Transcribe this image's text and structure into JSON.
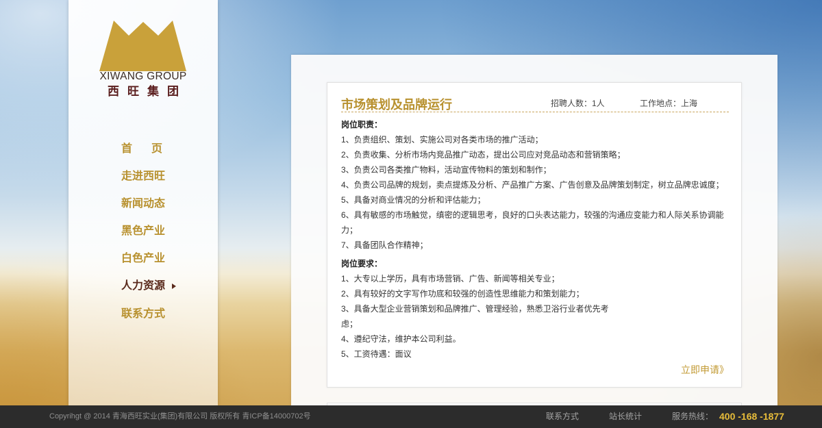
{
  "colors": {
    "accent_gold": "#b8912f",
    "active_nav": "#5a2a1c",
    "logo_gold": "#c9a13a",
    "footer_bg": "#2c2c2c",
    "hotline": "#e8bd3a"
  },
  "icons": {
    "logo_mark": "mountain-crown-icon",
    "nav_active": "triangle-right-icon"
  },
  "logo": {
    "name_en": "XIWANG GROUP",
    "name_cn": "西旺集团"
  },
  "nav": {
    "active_index": 5,
    "items": [
      {
        "label": "首　页"
      },
      {
        "label": "走进西旺"
      },
      {
        "label": "新闻动态"
      },
      {
        "label": "黑色产业"
      },
      {
        "label": "白色产业"
      },
      {
        "label": "人力资源"
      },
      {
        "label": "联系方式"
      }
    ]
  },
  "job": {
    "title": "市场策划及品牌运行",
    "headcount": "招聘人数：1人",
    "location": "工作地点：上海",
    "duties_heading": "岗位职责：",
    "duties": [
      "1、负责组织、策划、实施公司对各类市场的推广活动；",
      "2、负责收集、分析市场内竞品推广动态，提出公司应对竞品动态和营销策略；",
      "3、负责公司各类推广物料，活动宣传物料的策划和制作；",
      "4、负责公司品牌的规划，卖点提炼及分析、产品推广方案、广告创意及品牌策划制定，树立品牌忠诚度；",
      "5、具备对商业情况的分析和评估能力；",
      "6、具有敏感的市场触觉，缜密的逻辑思考，良好的口头表达能力，较强的沟通应变能力和人际关系协调能\n力；",
      "7、具备团队合作精神；"
    ],
    "requirements_heading": "岗位要求：",
    "requirements": [
      "1、大专以上学历，具有市场营销、广告、新闻等相关专业；",
      "2、具有较好的文字写作功底和较强的创造性思维能力和策划能力；",
      "3、具备大型企业营销策划和品牌推广、管理经验，熟悉卫浴行业者优先考\n虑；",
      "4、遵纪守法，维护本公司利益。",
      "5、工资待遇：面议"
    ],
    "apply_label": "立即申请》"
  },
  "footer": {
    "copyright": "Copyrihgt @ 2014 青海西旺实业(集团)有限公司 版权所有 青ICP备14000702号",
    "links": [
      "联系方式",
      "站长统计"
    ],
    "hotline_label": "服务热线：",
    "hotline_number": "400 -168 -1877"
  }
}
